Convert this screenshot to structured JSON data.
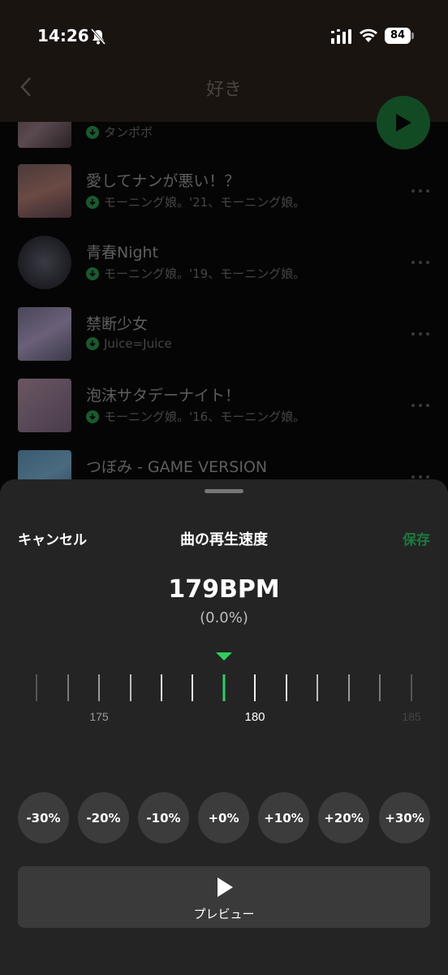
{
  "status_bar": {
    "time": "14:26",
    "battery": "84"
  },
  "header": {
    "title": "好き"
  },
  "songs": [
    {
      "title": "",
      "subtitle": "タンポポ"
    },
    {
      "title": "愛してナンが悪い！？",
      "subtitle": "モーニング娘。'21、モーニング娘。"
    },
    {
      "title": "青春Night",
      "subtitle": "モーニング娘。'19、モーニング娘。"
    },
    {
      "title": "禁断少女",
      "subtitle": "Juice=Juice"
    },
    {
      "title": "泡沫サタデーナイト！",
      "subtitle": "モーニング娘。'16、モーニング娘。"
    },
    {
      "title": "つぼみ - GAME VERSION",
      "subtitle": ""
    }
  ],
  "sheet": {
    "cancel": "キャンセル",
    "title": "曲の再生速度",
    "save": "保存",
    "bpm": "179BPM",
    "percent": "(0.0%)",
    "ruler_labels": [
      "175",
      "180",
      "185"
    ],
    "presets": [
      "-30%",
      "-20%",
      "-10%",
      "+0%",
      "+10%",
      "+20%",
      "+30%"
    ],
    "preview": "プレビュー"
  },
  "colors": {
    "accent": "#2bd15f",
    "save": "#1a7a3c",
    "sheet_bg": "#242424"
  },
  "icons": {
    "bell": "bell-slash-icon",
    "signal": "signal-icon",
    "wifi": "wifi-icon",
    "back": "chevron-left-icon",
    "play": "play-icon",
    "download": "download-icon",
    "more": "more-icon",
    "marker": "triangle-down-icon"
  }
}
